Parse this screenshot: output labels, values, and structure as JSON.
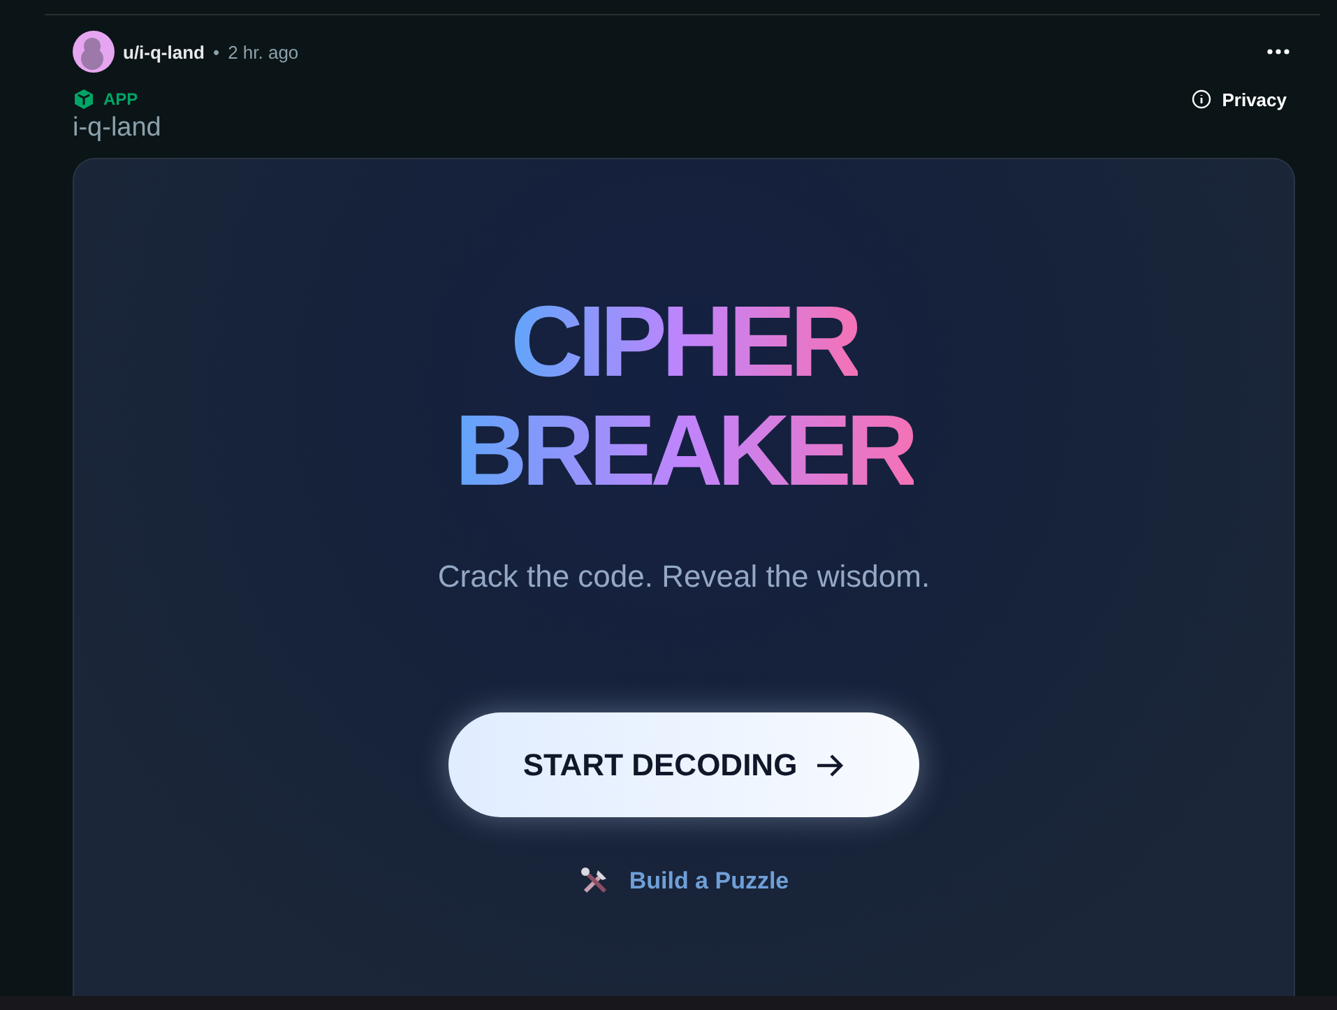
{
  "post": {
    "author": "u/i-q-land",
    "separator": "•",
    "time": "2 hr. ago",
    "badge": "APP",
    "title": "i-q-land",
    "privacy": "Privacy"
  },
  "app": {
    "title_lines": [
      "CIPHER",
      "BREAKER"
    ],
    "tagline": "Crack the code. Reveal the wisdom.",
    "primary_button": "START DECODING",
    "secondary_link": "Build a Puzzle"
  }
}
